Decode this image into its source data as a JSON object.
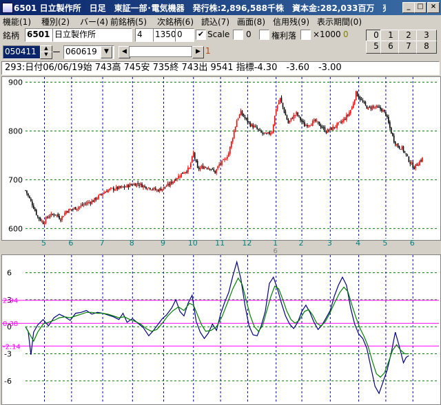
{
  "window": {
    "title": "6501 日立製作所　日足　東証一部･電気機器　発行株:2,896,588千株　資本金:282,033百万　売"
  },
  "menu": [
    {
      "label": "機能(1)"
    },
    {
      "label": "種別(2)"
    },
    {
      "label": "バー(4)"
    },
    {
      "label": "前銘柄(5)"
    },
    {
      "label": "次銘柄(6)"
    },
    {
      "label": "読込(7)"
    },
    {
      "label": "画面(8)"
    },
    {
      "label": "信用残(9)"
    },
    {
      "label": "表示期間(0)"
    }
  ],
  "toolbar": {
    "code_label": "銘柄",
    "code_value": "6501",
    "name_value": "日立製作所",
    "field1": "4",
    "field2": "1350",
    "field3": "0",
    "scale_label": "Scale",
    "scale_checked": "✔",
    "zero_label": "0",
    "rights_label": "権利落",
    "x1000_label": "×1000",
    "x1000_badge": "0",
    "date_from": "050411",
    "date_sep": "ー",
    "date_to": "060619",
    "page_indicator": "1",
    "panel_buttons": [
      "0",
      "1",
      "2",
      "3",
      "5",
      "6",
      "7",
      "8"
    ]
  },
  "info_line": "293:日付06/06/19始 743高 745安 735終 743出 9541 指標-4.30　-3.60　-3.00",
  "colors": {
    "title_bg": "#0a246a",
    "up_candle": "#ff0000",
    "down_candle": "#000000",
    "grid_blue": "#0000c0",
    "grid_green": "#008000",
    "osc_blue": "#000080",
    "osc_green": "#008000",
    "magenta": "#ff00ff",
    "month_label": "#008080"
  },
  "chart_data": [
    {
      "type": "candlestick",
      "name": "price",
      "ylim": [
        585,
        905
      ],
      "yticks": [
        600,
        700,
        800,
        900
      ],
      "xlim": [
        0,
        293
      ],
      "month_ticks": [
        {
          "label": "5",
          "x": 14
        },
        {
          "label": "6",
          "x": 34
        },
        {
          "label": "7",
          "x": 57
        },
        {
          "label": "8",
          "x": 79
        },
        {
          "label": "9",
          "x": 102
        },
        {
          "label": "10",
          "x": 124
        },
        {
          "label": "11",
          "x": 144
        },
        {
          "label": "12",
          "x": 164
        },
        {
          "label": "1",
          "x": 185
        },
        {
          "label": "2",
          "x": 204
        },
        {
          "label": "3",
          "x": 225
        },
        {
          "label": "4",
          "x": 246
        },
        {
          "label": "5",
          "x": 266
        },
        {
          "label": "6",
          "x": 286
        }
      ],
      "year_label": {
        "label": "6",
        "x": 185
      },
      "keypoints": [
        [
          0,
          678
        ],
        [
          5,
          650
        ],
        [
          9,
          624
        ],
        [
          13,
          612
        ],
        [
          17,
          626
        ],
        [
          22,
          630
        ],
        [
          26,
          620
        ],
        [
          30,
          636
        ],
        [
          35,
          640
        ],
        [
          40,
          645
        ],
        [
          45,
          652
        ],
        [
          50,
          657
        ],
        [
          55,
          668
        ],
        [
          60,
          678
        ],
        [
          66,
          682
        ],
        [
          72,
          684
        ],
        [
          78,
          690
        ],
        [
          83,
          692
        ],
        [
          88,
          686
        ],
        [
          93,
          683
        ],
        [
          97,
          678
        ],
        [
          101,
          682
        ],
        [
          106,
          690
        ],
        [
          110,
          700
        ],
        [
          115,
          712
        ],
        [
          118,
          718
        ],
        [
          121,
          723
        ],
        [
          124,
          755
        ],
        [
          127,
          722
        ],
        [
          132,
          727
        ],
        [
          136,
          725
        ],
        [
          140,
          715
        ],
        [
          143,
          731
        ],
        [
          147,
          740
        ],
        [
          150,
          755
        ],
        [
          153,
          788
        ],
        [
          156,
          822
        ],
        [
          159,
          838
        ],
        [
          162,
          826
        ],
        [
          166,
          813
        ],
        [
          170,
          806
        ],
        [
          174,
          796
        ],
        [
          178,
          792
        ],
        [
          182,
          799
        ],
        [
          185,
          846
        ],
        [
          188,
          866
        ],
        [
          191,
          840
        ],
        [
          194,
          816
        ],
        [
          197,
          828
        ],
        [
          200,
          836
        ],
        [
          203,
          823
        ],
        [
          206,
          811
        ],
        [
          210,
          815
        ],
        [
          214,
          820
        ],
        [
          218,
          810
        ],
        [
          222,
          799
        ],
        [
          226,
          805
        ],
        [
          230,
          812
        ],
        [
          234,
          820
        ],
        [
          238,
          833
        ],
        [
          241,
          848
        ],
        [
          244,
          878
        ],
        [
          247,
          866
        ],
        [
          250,
          855
        ],
        [
          253,
          846
        ],
        [
          256,
          850
        ],
        [
          259,
          848
        ],
        [
          263,
          844
        ],
        [
          266,
          834
        ],
        [
          269,
          806
        ],
        [
          272,
          780
        ],
        [
          275,
          768
        ],
        [
          278,
          765
        ],
        [
          281,
          750
        ],
        [
          284,
          735
        ],
        [
          287,
          725
        ],
        [
          290,
          735
        ],
        [
          293,
          743
        ]
      ]
    },
    {
      "type": "line",
      "name": "oscillator",
      "ylim": [
        -8.3,
        7.8
      ],
      "yticks": [
        {
          "label": "6",
          "v": 6
        },
        {
          "label": "3",
          "v": 3
        },
        {
          "label": "0",
          "v": 0
        },
        {
          "label": "-3",
          "v": -3
        },
        {
          "label": "-6",
          "v": -6
        }
      ],
      "reference_lines": [
        {
          "label": "2.94",
          "v": 2.94
        },
        {
          "label": "0.38",
          "v": 0.38
        },
        {
          "label": "-2.14",
          "v": -2.14
        }
      ],
      "series": [
        {
          "color": "#000080",
          "values": [
            [
              0,
              0
            ],
            [
              2,
              -0.5
            ],
            [
              4,
              -3.1
            ],
            [
              6,
              -0.6
            ],
            [
              9,
              0.2
            ],
            [
              13,
              0.8
            ],
            [
              17,
              0.1
            ],
            [
              21,
              1.0
            ],
            [
              25,
              1.4
            ],
            [
              29,
              1.1
            ],
            [
              33,
              0.7
            ],
            [
              37,
              1.5
            ],
            [
              41,
              1.6
            ],
            [
              45,
              1.8
            ],
            [
              49,
              1.4
            ],
            [
              53,
              1.6
            ],
            [
              57,
              1.5
            ],
            [
              61,
              1.3
            ],
            [
              65,
              1.1
            ],
            [
              69,
              0.8
            ],
            [
              72,
              1.5
            ],
            [
              75,
              0.5
            ],
            [
              79,
              0.9
            ],
            [
              83,
              0.4
            ],
            [
              87,
              -0.1
            ],
            [
              91,
              -1.0
            ],
            [
              94,
              -0.5
            ],
            [
              97,
              0.1
            ],
            [
              101,
              0.9
            ],
            [
              104,
              1.3
            ],
            [
              108,
              2.1
            ],
            [
              111,
              3.0
            ],
            [
              114,
              1.7
            ],
            [
              117,
              1.2
            ],
            [
              120,
              2.6
            ],
            [
              123,
              3.5
            ],
            [
              126,
              0.6
            ],
            [
              129,
              -0.6
            ],
            [
              132,
              -1.3
            ],
            [
              135,
              -0.7
            ],
            [
              138,
              0.3
            ],
            [
              141,
              -0.4
            ],
            [
              144,
              1.4
            ],
            [
              147,
              2.7
            ],
            [
              150,
              3.8
            ],
            [
              153,
              5.6
            ],
            [
              156,
              7.2
            ],
            [
              159,
              5.3
            ],
            [
              162,
              2.4
            ],
            [
              165,
              0.1
            ],
            [
              168,
              -0.9
            ],
            [
              171,
              -1.0
            ],
            [
              174,
              0.1
            ],
            [
              177,
              1.7
            ],
            [
              180,
              4.8
            ],
            [
              183,
              5.5
            ],
            [
              186,
              4.2
            ],
            [
              189,
              2.6
            ],
            [
              192,
              1.2
            ],
            [
              195,
              0.3
            ],
            [
              198,
              -0.2
            ],
            [
              201,
              0.5
            ],
            [
              204,
              1.7
            ],
            [
              207,
              2.4
            ],
            [
              210,
              1.6
            ],
            [
              213,
              0.5
            ],
            [
              216,
              -0.3
            ],
            [
              219,
              0.2
            ],
            [
              222,
              1.0
            ],
            [
              225,
              1.8
            ],
            [
              228,
              3.4
            ],
            [
              231,
              4.6
            ],
            [
              234,
              5.5
            ],
            [
              237,
              4.6
            ],
            [
              240,
              2.1
            ],
            [
              243,
              0.3
            ],
            [
              246,
              -0.8
            ],
            [
              249,
              -1.3
            ],
            [
              252,
              -2.4
            ],
            [
              255,
              -4.5
            ],
            [
              258,
              -6.6
            ],
            [
              261,
              -7.4
            ],
            [
              264,
              -6.1
            ],
            [
              267,
              -4.8
            ],
            [
              270,
              -2.9
            ],
            [
              273,
              -0.6
            ],
            [
              276,
              -2.2
            ],
            [
              279,
              -4.0
            ],
            [
              281,
              -3.4
            ],
            [
              283,
              -3.2
            ]
          ]
        },
        {
          "color": "#008000",
          "values": [
            [
              0,
              0
            ],
            [
              3,
              -0.8
            ],
            [
              6,
              -1.6
            ],
            [
              9,
              -0.6
            ],
            [
              13,
              0.3
            ],
            [
              17,
              0.5
            ],
            [
              21,
              0.7
            ],
            [
              25,
              1.0
            ],
            [
              29,
              1.1
            ],
            [
              33,
              1.0
            ],
            [
              37,
              1.2
            ],
            [
              41,
              1.4
            ],
            [
              45,
              1.6
            ],
            [
              49,
              1.6
            ],
            [
              53,
              1.5
            ],
            [
              57,
              1.5
            ],
            [
              61,
              1.4
            ],
            [
              65,
              1.2
            ],
            [
              69,
              1.0
            ],
            [
              73,
              1.1
            ],
            [
              77,
              0.8
            ],
            [
              81,
              0.6
            ],
            [
              85,
              0.3
            ],
            [
              89,
              -0.2
            ],
            [
              93,
              -0.5
            ],
            [
              97,
              -0.3
            ],
            [
              101,
              0.4
            ],
            [
              105,
              1.2
            ],
            [
              109,
              1.8
            ],
            [
              113,
              2.2
            ],
            [
              117,
              1.8
            ],
            [
              121,
              2.6
            ],
            [
              124,
              2.4
            ],
            [
              127,
              1.3
            ],
            [
              130,
              0.2
            ],
            [
              133,
              -0.5
            ],
            [
              137,
              -0.4
            ],
            [
              141,
              0.0
            ],
            [
              145,
              1.1
            ],
            [
              149,
              2.6
            ],
            [
              153,
              4.2
            ],
            [
              157,
              5.4
            ],
            [
              160,
              4.7
            ],
            [
              163,
              2.9
            ],
            [
              166,
              1.2
            ],
            [
              169,
              0.0
            ],
            [
              172,
              -0.5
            ],
            [
              175,
              0.1
            ],
            [
              178,
              1.7
            ],
            [
              181,
              3.3
            ],
            [
              184,
              4.5
            ],
            [
              187,
              4.2
            ],
            [
              190,
              3.0
            ],
            [
              193,
              1.7
            ],
            [
              196,
              0.8
            ],
            [
              199,
              0.4
            ],
            [
              202,
              0.7
            ],
            [
              206,
              1.7
            ],
            [
              209,
              1.9
            ],
            [
              212,
              1.3
            ],
            [
              215,
              0.4
            ],
            [
              218,
              0.1
            ],
            [
              221,
              0.5
            ],
            [
              224,
              1.3
            ],
            [
              228,
              2.6
            ],
            [
              232,
              3.8
            ],
            [
              235,
              4.4
            ],
            [
              238,
              3.9
            ],
            [
              241,
              2.4
            ],
            [
              244,
              1.0
            ],
            [
              247,
              -0.2
            ],
            [
              250,
              -1.1
            ],
            [
              253,
              -2.2
            ],
            [
              256,
              -3.8
            ],
            [
              259,
              -5.2
            ],
            [
              262,
              -5.6
            ],
            [
              265,
              -5.1
            ],
            [
              268,
              -3.9
            ],
            [
              271,
              -2.6
            ],
            [
              274,
              -2.0
            ],
            [
              277,
              -2.6
            ],
            [
              280,
              -3.0
            ],
            [
              283,
              -3.0
            ]
          ]
        }
      ]
    }
  ]
}
